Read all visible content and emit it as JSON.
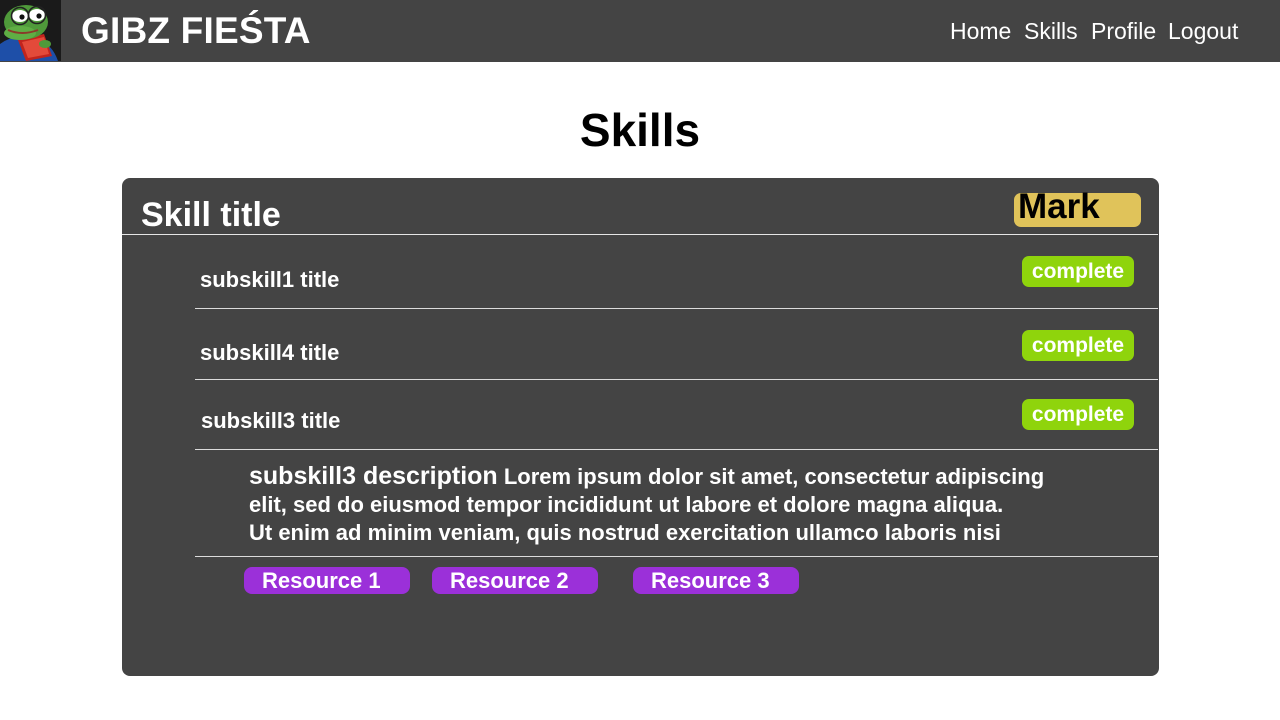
{
  "header": {
    "brand": "GIBZ FIEŚTA",
    "logo_icon": "frog-reading-book-icon",
    "nav": [
      {
        "label": "Home"
      },
      {
        "label": "Skills"
      },
      {
        "label": "Profile"
      },
      {
        "label": "Logout"
      }
    ]
  },
  "page": {
    "title": "Skills"
  },
  "skill": {
    "title": "Skill title",
    "mark_label": "Mark",
    "subskills": [
      {
        "title": "subskill1 title",
        "status": "complete"
      },
      {
        "title": "subskill4 title",
        "status": "complete"
      },
      {
        "title": "subskill3 title",
        "status": "complete"
      }
    ],
    "expanded": {
      "label": "subskill3 description",
      "text_line1": "Lorem ipsum dolor sit amet, consectetur adipiscing",
      "text_line2": "elit, sed do eiusmod tempor incididunt ut labore et dolore magna aliqua.",
      "text_line3": "Ut enim ad minim veniam, quis nostrud exercitation ullamco laboris nisi"
    },
    "resources": [
      {
        "label": "Resource 1"
      },
      {
        "label": "Resource 2"
      },
      {
        "label": "Resource 3"
      }
    ]
  },
  "colors": {
    "header_bg": "#444444",
    "card_bg": "#444444",
    "mark_button": "#e0c35a",
    "complete_button": "#8fd40c",
    "resource_button": "#9b30d9"
  }
}
